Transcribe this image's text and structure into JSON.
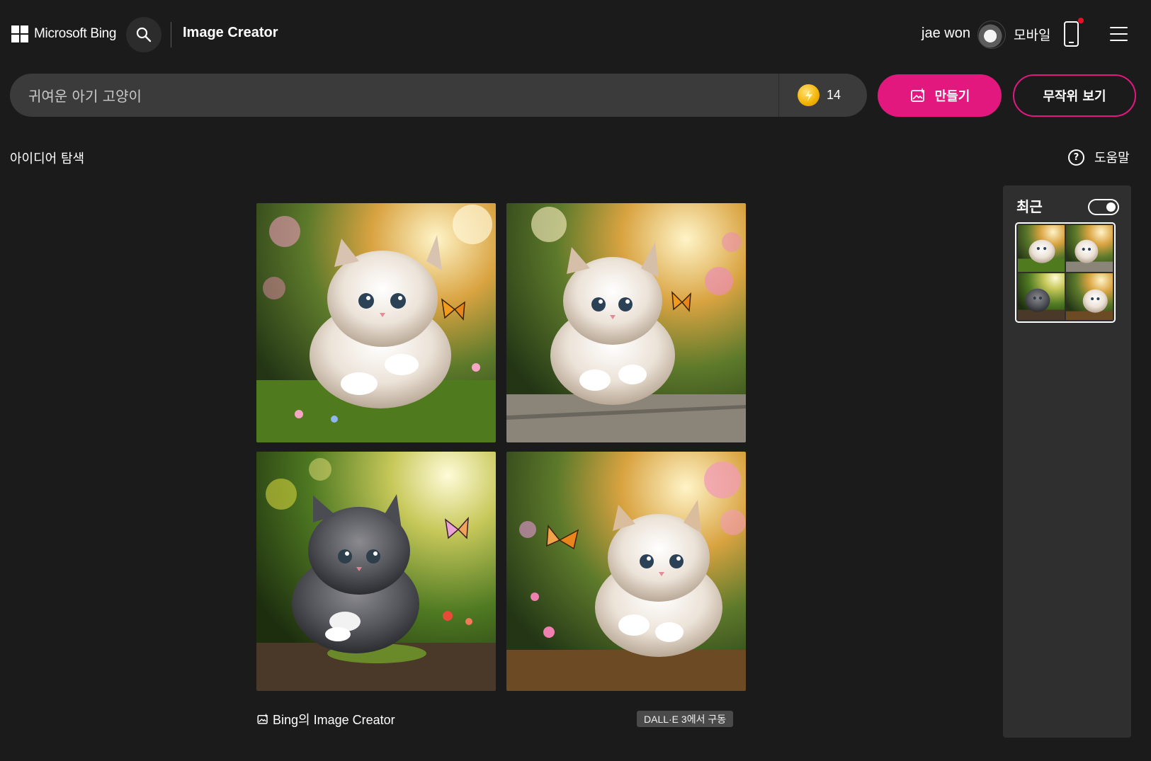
{
  "header": {
    "brand": "Microsoft Bing",
    "title": "Image Creator",
    "user_name": "jae won",
    "mobile_label": "모바일",
    "icons": [
      "windows-logo-icon",
      "search-icon",
      "avatar",
      "phone-icon",
      "hamburger-menu-icon"
    ]
  },
  "prompt": {
    "value": "귀여운 아기 고양이",
    "boost_count": "14"
  },
  "actions": {
    "create_label": "만들기",
    "random_label": "무작위 보기"
  },
  "subnav": {
    "explore_label": "아이디어 탐색",
    "help_label": "도움말"
  },
  "results": {
    "images": [
      {
        "subject": "white-grey fluffy kitten walking on grass with orange butterfly"
      },
      {
        "subject": "white-grey fluffy kitten walking on stone path with orange butterfly"
      },
      {
        "subject": "dark grey fluffy kitten on log with pink butterfly"
      },
      {
        "subject": "white-beige fluffy kitten among flowers with orange butterfly"
      }
    ],
    "footer_brand": "Bing의 Image Creator",
    "powered_by": "DALL·E 3에서 구동"
  },
  "recent": {
    "title": "최근",
    "toggle_on": true
  },
  "colors": {
    "background": "#1b1b1b",
    "accent": "#e2187f",
    "panel": "#2f2f2f",
    "input": "#3b3b3b"
  }
}
